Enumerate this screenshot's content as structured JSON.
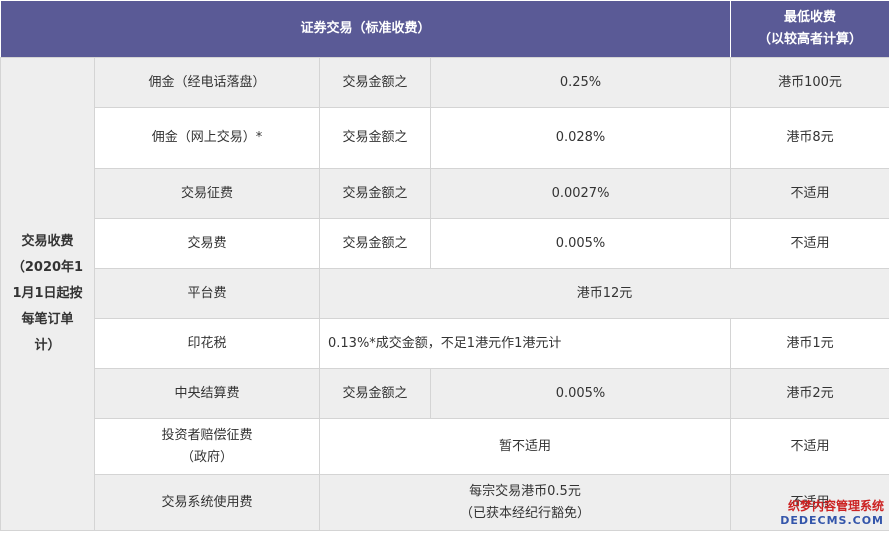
{
  "header": {
    "standard_fee": "证券交易（标准收费）",
    "min_fee_line1": "最低收费",
    "min_fee_line2": "（以较高者计算）"
  },
  "side_label": {
    "line1": "交易收费",
    "line2": "（2020年1",
    "line3": "1月1日起按",
    "line4": "每笔订单",
    "line5": "计）"
  },
  "rows": [
    {
      "item": "佣金（经电话落盘）",
      "basis": "交易金额之",
      "rate": "0.25%",
      "minimum": "港币100元"
    },
    {
      "item": "佣金（网上交易）*",
      "basis": "交易金额之",
      "rate": "0.028%",
      "minimum": "港币8元"
    },
    {
      "item": "交易征费",
      "basis": "交易金额之",
      "rate": "0.0027%",
      "minimum": "不适用"
    },
    {
      "item": "交易费",
      "basis": "交易金额之",
      "rate": "0.005%",
      "minimum": "不适用"
    },
    {
      "item": "平台费",
      "merged": "港币12元"
    },
    {
      "item": "印花税",
      "merged": "0.13%*成交金额，不足1港元作1港元计",
      "minimum": "港币1元"
    },
    {
      "item": "中央结算费",
      "basis": "交易金额之",
      "rate": "0.005%",
      "minimum": "港币2元"
    },
    {
      "item_line1": "投资者赔偿征费",
      "item_line2": "（政府）",
      "merged": "暂不适用",
      "minimum": "不适用"
    },
    {
      "item": "交易系统使用费",
      "merged_line1": "每宗交易港币0.5元",
      "merged_line2": "（已获本经纪行豁免）",
      "minimum": "不适用"
    }
  ],
  "watermark": {
    "line1": "织梦内容管理系统",
    "line2": "DEDECMS.COM"
  }
}
